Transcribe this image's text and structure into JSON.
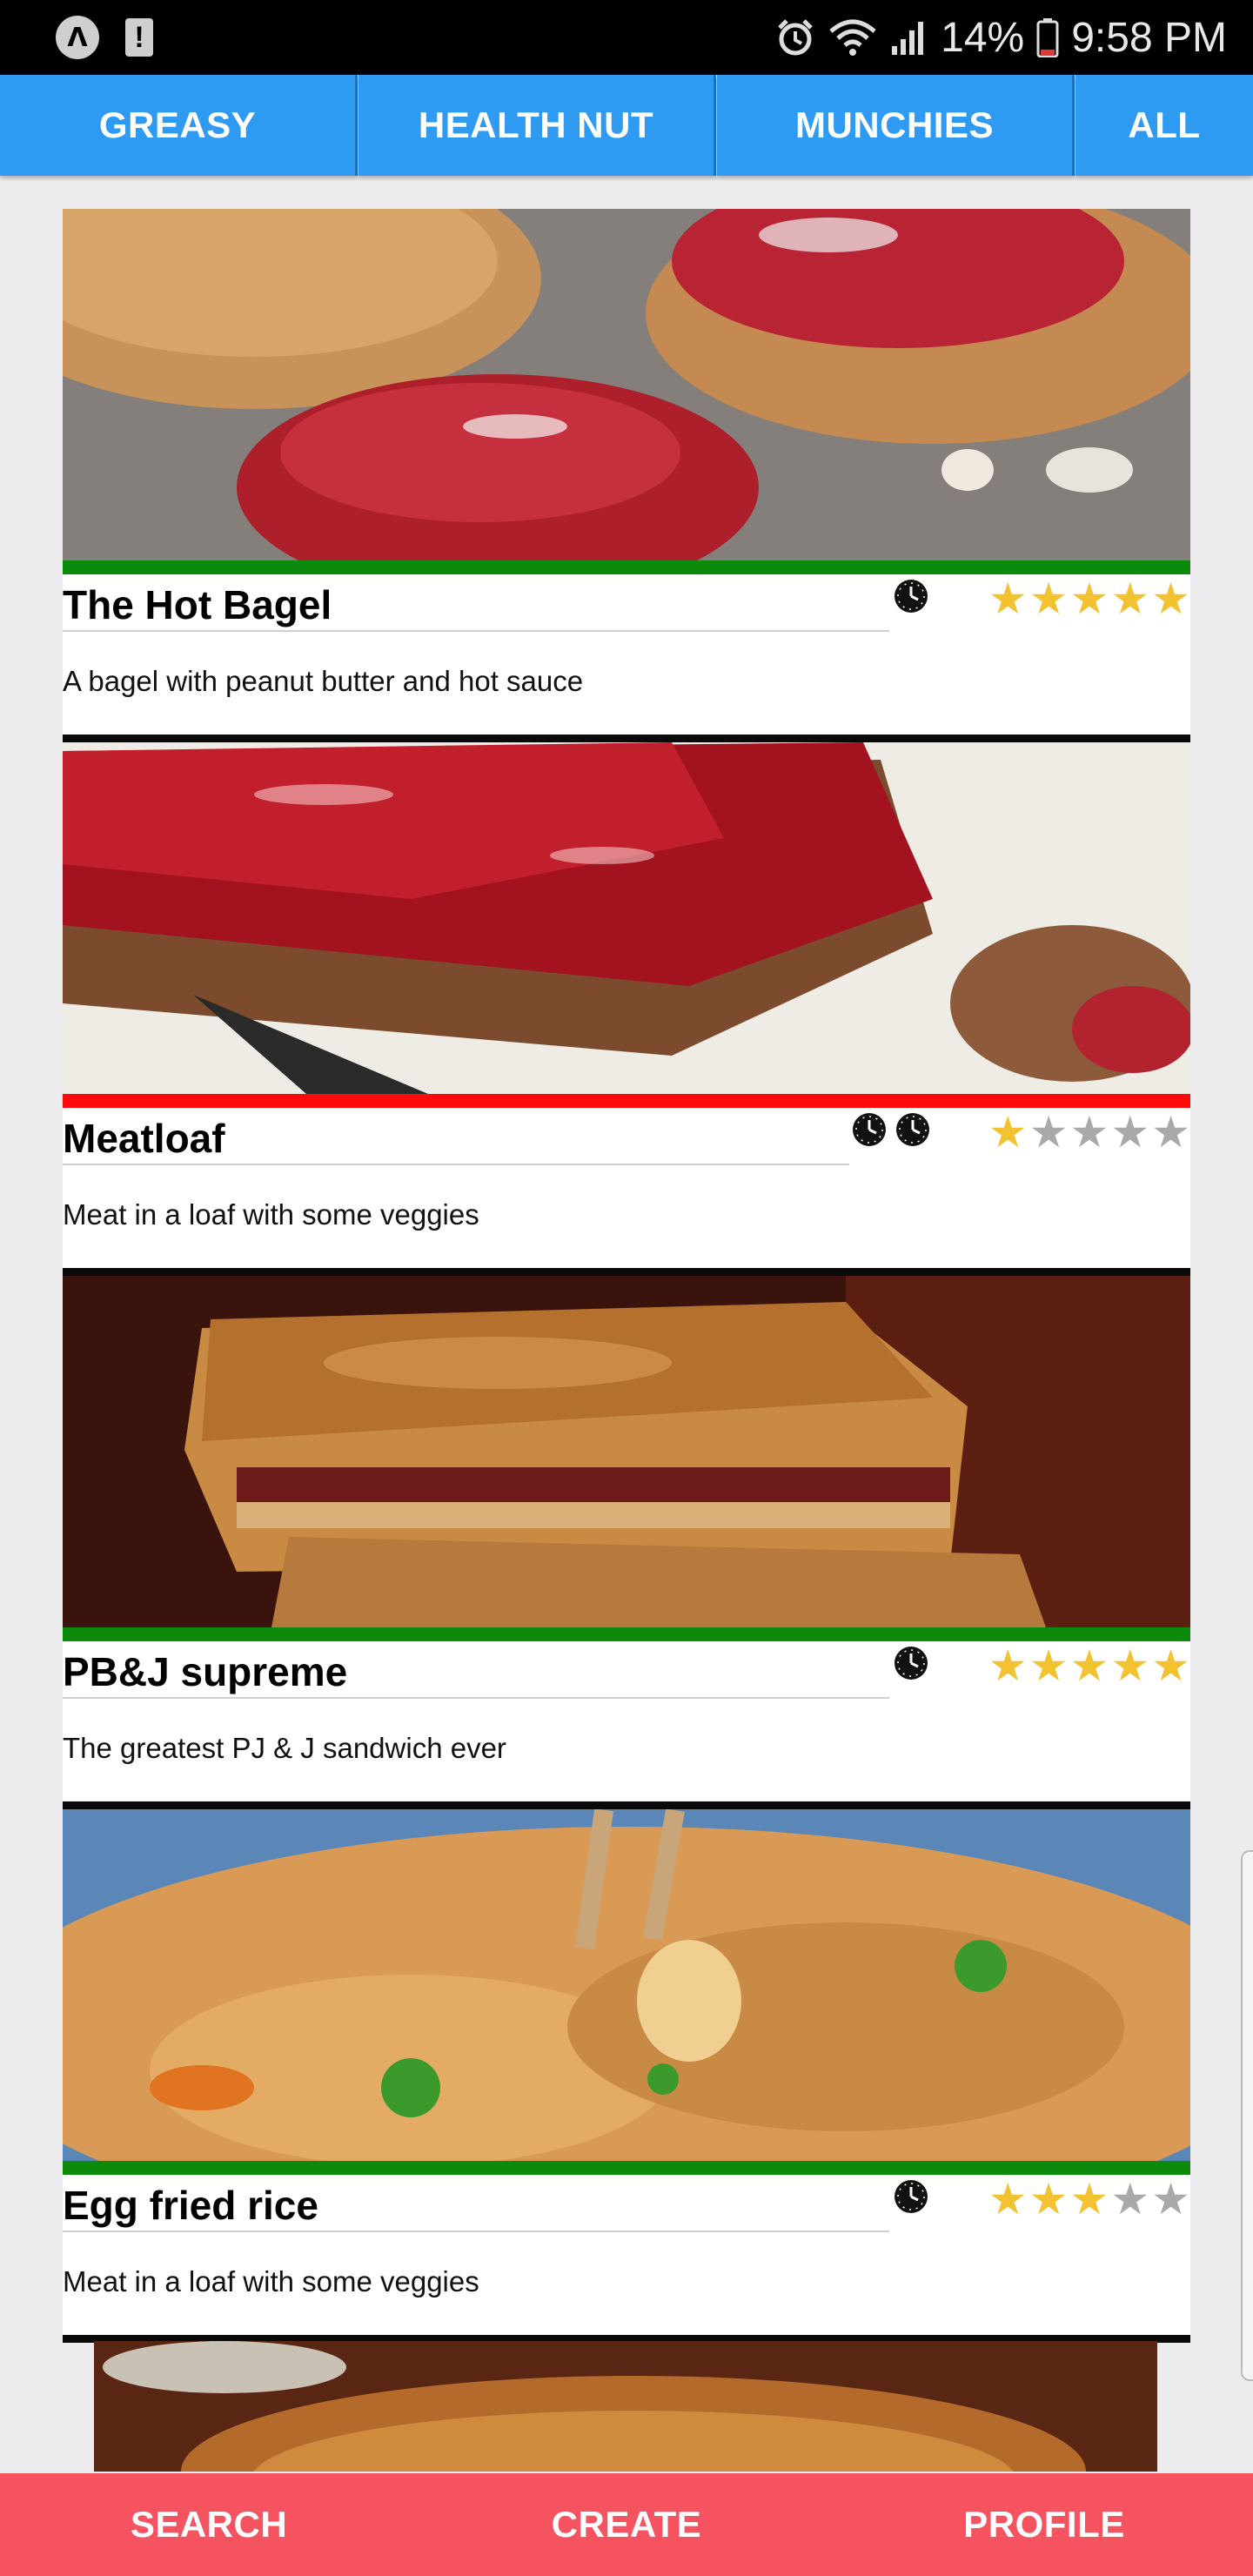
{
  "status_bar": {
    "battery": "14%",
    "time": "9:58 PM"
  },
  "tabs": [
    "GREASY",
    "HEALTH NUT",
    "MUNCHIES",
    "ALL"
  ],
  "recipes": [
    {
      "title": "The Hot Bagel",
      "description": "A bagel with peanut butter and hot sauce",
      "difficulty_color": "#0b8a0b",
      "time_clocks": 1,
      "rating": 5
    },
    {
      "title": "Meatloaf",
      "description": "Meat in a loaf with some veggies",
      "difficulty_color": "#ff0a0a",
      "time_clocks": 2,
      "rating": 1
    },
    {
      "title": "PB&J supreme",
      "description": "The greatest PJ & J sandwich ever",
      "difficulty_color": "#0b8a0b",
      "time_clocks": 1,
      "rating": 5
    },
    {
      "title": "Egg fried rice",
      "description": "Meat in a loaf with some veggies",
      "difficulty_color": "#0b8a0b",
      "time_clocks": 1,
      "rating": 3
    }
  ],
  "bottom_nav": {
    "search": "SEARCH",
    "create": "CREATE",
    "profile": "PROFILE"
  },
  "colors": {
    "tab_blue": "#2e9af2",
    "nav_red": "#f5535f",
    "star_on": "#f2c230",
    "star_off": "#a9a9a9"
  },
  "icons": {
    "clock": "clock-icon",
    "star": "star-icon"
  }
}
